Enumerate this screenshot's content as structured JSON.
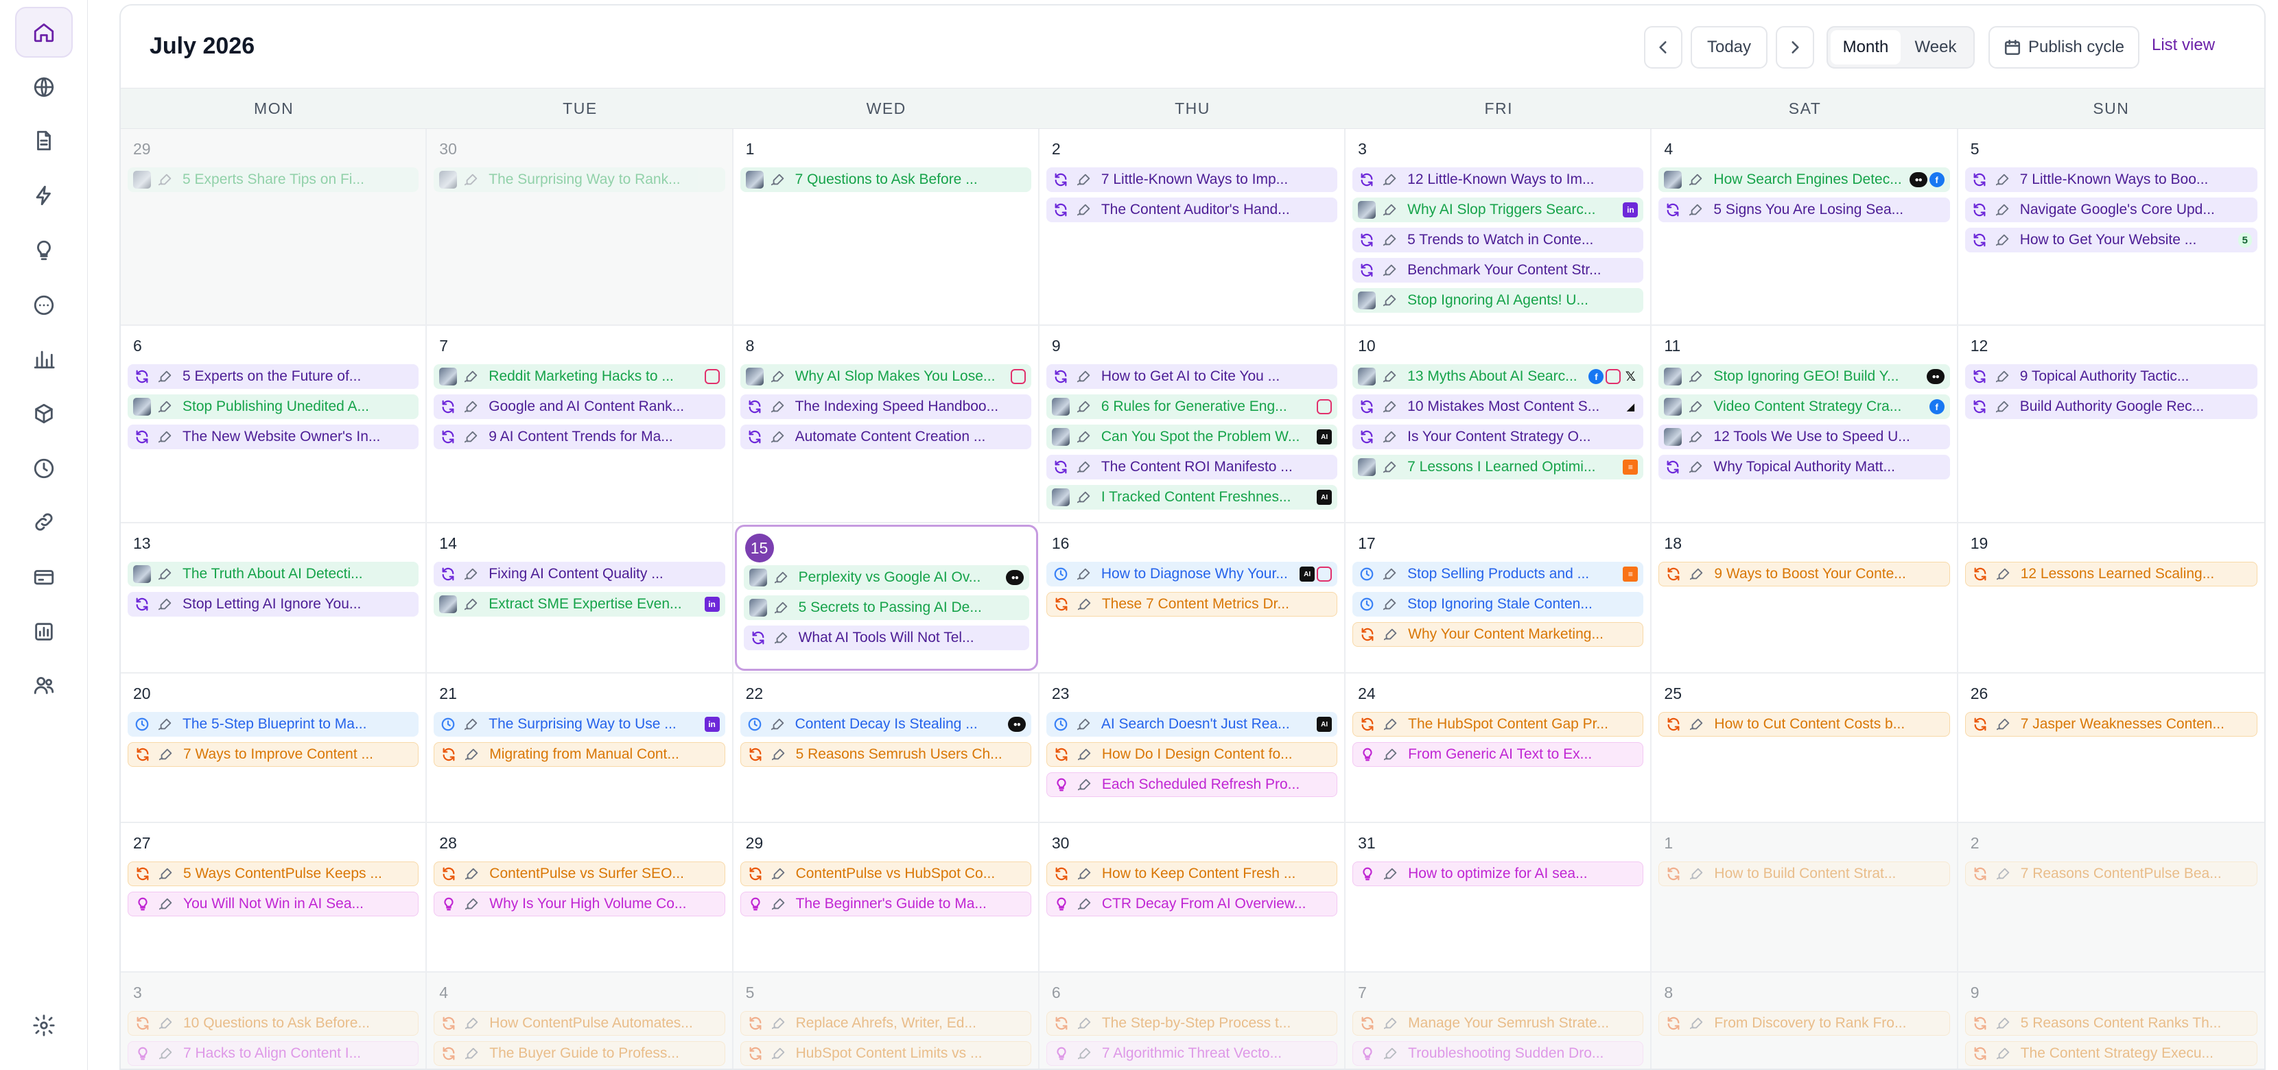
{
  "sidebar": {
    "items": [
      {
        "icon": "home-icon",
        "active": true
      },
      {
        "icon": "globe-icon"
      },
      {
        "icon": "document-icon"
      },
      {
        "icon": "lightning-icon"
      },
      {
        "icon": "lightbulb-icon"
      },
      {
        "icon": "more-circle-icon"
      },
      {
        "icon": "bar-chart-icon"
      },
      {
        "icon": "cube-icon"
      },
      {
        "icon": "clock-icon"
      },
      {
        "icon": "link-icon"
      },
      {
        "icon": "credit-card-icon"
      },
      {
        "icon": "analytics-icon"
      },
      {
        "icon": "users-icon"
      }
    ],
    "settings_icon": "settings-icon"
  },
  "header": {
    "title": "July 2026",
    "today_label": "Today",
    "month_label": "Month",
    "week_label": "Week",
    "publish_cycle_label": "Publish cycle",
    "list_view_label": "List view"
  },
  "weekdays": [
    "MON",
    "TUE",
    "WED",
    "THU",
    "FRI",
    "SAT",
    "SUN"
  ],
  "weeks": [
    {
      "days": [
        {
          "num": "29",
          "other": true,
          "events": [
            {
              "color": "green",
              "lead": "thumb",
              "title": "5 Experts Share Tips on Fi..."
            }
          ]
        },
        {
          "num": "30",
          "other": true,
          "events": [
            {
              "color": "green",
              "lead": "thumb",
              "title": "The Surprising Way to Rank..."
            }
          ]
        },
        {
          "num": "1",
          "events": [
            {
              "color": "green",
              "lead": "thumb",
              "title": "7 Questions to Ask Before ..."
            }
          ]
        },
        {
          "num": "2",
          "events": [
            {
              "color": "purple",
              "lead": "refresh",
              "title": "7 Little-Known Ways to Imp..."
            },
            {
              "color": "purple",
              "lead": "refresh",
              "title": "The Content Auditor's Hand..."
            }
          ]
        },
        {
          "num": "3",
          "events": [
            {
              "color": "purple",
              "lead": "refresh",
              "title": "12 Little-Known Ways to Im..."
            },
            {
              "color": "green",
              "lead": "thumb",
              "title": "Why AI Slop Triggers Searc...",
              "plats": [
                "li"
              ]
            },
            {
              "color": "purple",
              "lead": "refresh",
              "title": "5 Trends to Watch in Conte..."
            },
            {
              "color": "purple",
              "lead": "refresh",
              "title": "Benchmark Your Content Str..."
            },
            {
              "color": "green",
              "lead": "thumb",
              "title": "Stop Ignoring AI Agents! U..."
            }
          ]
        },
        {
          "num": "4",
          "events": [
            {
              "color": "green",
              "lead": "thumb",
              "title": "How Search Engines Detec...",
              "plats": [
                "med",
                "fb"
              ]
            },
            {
              "color": "purple",
              "lead": "refresh",
              "title": "5 Signs You Are Losing Sea..."
            }
          ]
        },
        {
          "num": "5",
          "events": [
            {
              "color": "purple",
              "lead": "refresh",
              "title": "7 Little-Known Ways to Boo..."
            },
            {
              "color": "purple",
              "lead": "refresh",
              "title": "Navigate Google's Core Upd..."
            },
            {
              "color": "purple",
              "lead": "refresh",
              "title": "How to Get Your Website ...",
              "plats": [
                "count"
              ],
              "count": "5"
            }
          ]
        }
      ]
    },
    {
      "days": [
        {
          "num": "6",
          "events": [
            {
              "color": "purple",
              "lead": "refresh",
              "title": "5 Experts on the Future of..."
            },
            {
              "color": "green",
              "lead": "thumb",
              "title": "Stop Publishing Unedited A..."
            },
            {
              "color": "purple",
              "lead": "refresh",
              "title": "The New Website Owner's In..."
            }
          ]
        },
        {
          "num": "7",
          "events": [
            {
              "color": "green",
              "lead": "thumb",
              "title": "Reddit Marketing Hacks to ...",
              "plats": [
                "ig"
              ]
            },
            {
              "color": "purple",
              "lead": "refresh",
              "title": "Google and AI Content Rank..."
            },
            {
              "color": "purple",
              "lead": "refresh",
              "title": "9 AI Content Trends for Ma..."
            }
          ]
        },
        {
          "num": "8",
          "events": [
            {
              "color": "green",
              "lead": "thumb",
              "title": "Why AI Slop Makes You Lose...",
              "plats": [
                "ig"
              ]
            },
            {
              "color": "purple",
              "lead": "refresh",
              "title": "The Indexing Speed Handboo..."
            },
            {
              "color": "purple",
              "lead": "refresh",
              "title": "Automate Content Creation ..."
            }
          ]
        },
        {
          "num": "9",
          "events": [
            {
              "color": "purple",
              "lead": "refresh",
              "title": "How to Get AI to Cite You ..."
            },
            {
              "color": "green",
              "lead": "thumb",
              "title": "6 Rules for Generative Eng...",
              "plats": [
                "ig"
              ]
            },
            {
              "color": "green",
              "lead": "thumb",
              "title": "Can You Spot the Problem W...",
              "plats": [
                "ai"
              ]
            },
            {
              "color": "purple",
              "lead": "refresh",
              "title": "The Content ROI Manifesto ..."
            },
            {
              "color": "green",
              "lead": "thumb",
              "title": "I Tracked Content Freshnes...",
              "plats": [
                "ai"
              ]
            }
          ]
        },
        {
          "num": "10",
          "events": [
            {
              "color": "green",
              "lead": "thumb",
              "title": "13 Myths About AI Searc...",
              "plats": [
                "fb",
                "ig",
                "x"
              ]
            },
            {
              "color": "purple",
              "lead": "refresh",
              "title": "10 Mistakes Most Content S...",
              "plats": [
                "bars"
              ]
            },
            {
              "color": "purple",
              "lead": "refresh",
              "title": "Is Your Content Strategy O..."
            },
            {
              "color": "green",
              "lead": "thumb",
              "title": "7 Lessons I Learned Optimi...",
              "plats": [
                "sub"
              ]
            }
          ]
        },
        {
          "num": "11",
          "events": [
            {
              "color": "green",
              "lead": "thumb",
              "title": "Stop Ignoring GEO! Build Y...",
              "plats": [
                "med"
              ]
            },
            {
              "color": "green",
              "lead": "thumb",
              "title": "Video Content Strategy Cra...",
              "plats": [
                "fb"
              ]
            },
            {
              "color": "purple",
              "lead": "thumb",
              "title": "12 Tools We Use to Speed U..."
            },
            {
              "color": "purple",
              "lead": "refresh",
              "title": "Why Topical Authority Matt..."
            }
          ]
        },
        {
          "num": "12",
          "events": [
            {
              "color": "purple",
              "lead": "refresh",
              "title": "9 Topical Authority Tactic..."
            },
            {
              "color": "purple",
              "lead": "refresh",
              "title": "Build Authority Google Rec..."
            }
          ]
        }
      ]
    },
    {
      "days": [
        {
          "num": "13",
          "events": [
            {
              "color": "green",
              "lead": "thumb",
              "title": "The Truth About AI Detecti..."
            },
            {
              "color": "purple",
              "lead": "refresh",
              "title": "Stop Letting AI Ignore You..."
            }
          ]
        },
        {
          "num": "14",
          "events": [
            {
              "color": "purple",
              "lead": "refresh",
              "title": "Fixing AI Content Quality ..."
            },
            {
              "color": "green",
              "lead": "thumb",
              "title": "Extract SME Expertise Even...",
              "plats": [
                "li"
              ]
            }
          ]
        },
        {
          "num": "15",
          "today": true,
          "events": [
            {
              "color": "green",
              "lead": "thumb",
              "title": "Perplexity vs Google AI Ov...",
              "plats": [
                "med"
              ]
            },
            {
              "color": "green",
              "lead": "thumb",
              "title": "5 Secrets to Passing AI De..."
            },
            {
              "color": "purple",
              "lead": "refresh",
              "title": "What AI Tools Will Not Tel..."
            }
          ]
        },
        {
          "num": "16",
          "events": [
            {
              "color": "blue",
              "lead": "clock",
              "title": "How to Diagnose Why Your...",
              "plats": [
                "ai",
                "ig"
              ]
            },
            {
              "color": "orange",
              "lead": "refresh",
              "title": "These 7 Content Metrics Dr..."
            }
          ]
        },
        {
          "num": "17",
          "events": [
            {
              "color": "blue",
              "lead": "clock",
              "title": "Stop Selling Products and ...",
              "plats": [
                "sub"
              ]
            },
            {
              "color": "blue",
              "lead": "clock",
              "title": "Stop Ignoring Stale Conten..."
            },
            {
              "color": "orange",
              "lead": "refresh",
              "title": "Why Your Content Marketing..."
            }
          ]
        },
        {
          "num": "18",
          "events": [
            {
              "color": "orange",
              "lead": "refresh",
              "title": "9 Ways to Boost Your Conte..."
            }
          ]
        },
        {
          "num": "19",
          "events": [
            {
              "color": "orange",
              "lead": "refresh",
              "title": "12 Lessons Learned Scaling..."
            }
          ]
        }
      ]
    },
    {
      "days": [
        {
          "num": "20",
          "events": [
            {
              "color": "blue",
              "lead": "clock",
              "title": "The 5-Step Blueprint to Ma..."
            },
            {
              "color": "orange",
              "lead": "refresh",
              "title": "7 Ways to Improve Content ..."
            }
          ]
        },
        {
          "num": "21",
          "events": [
            {
              "color": "blue",
              "lead": "clock",
              "title": "The Surprising Way to Use ...",
              "plats": [
                "li"
              ]
            },
            {
              "color": "orange",
              "lead": "refresh",
              "title": "Migrating from Manual Cont..."
            }
          ]
        },
        {
          "num": "22",
          "events": [
            {
              "color": "blue",
              "lead": "clock",
              "title": "Content Decay Is Stealing ...",
              "plats": [
                "med"
              ]
            },
            {
              "color": "orange",
              "lead": "refresh",
              "title": "5 Reasons Semrush Users Ch..."
            }
          ]
        },
        {
          "num": "23",
          "events": [
            {
              "color": "blue",
              "lead": "clock",
              "title": "AI Search Doesn't Just Rea...",
              "plats": [
                "ai"
              ]
            },
            {
              "color": "orange",
              "lead": "refresh",
              "title": "How Do I Design Content fo..."
            },
            {
              "color": "pink",
              "lead": "bulb",
              "title": "Each Scheduled Refresh Pro..."
            }
          ]
        },
        {
          "num": "24",
          "events": [
            {
              "color": "orange",
              "lead": "refresh",
              "title": "The HubSpot Content Gap Pr..."
            },
            {
              "color": "pink",
              "lead": "bulb",
              "title": "From Generic AI Text to Ex..."
            }
          ]
        },
        {
          "num": "25",
          "events": [
            {
              "color": "orange",
              "lead": "refresh",
              "title": "How to Cut Content Costs b..."
            }
          ]
        },
        {
          "num": "26",
          "events": [
            {
              "color": "orange",
              "lead": "refresh",
              "title": "7 Jasper Weaknesses Conten..."
            }
          ]
        }
      ]
    },
    {
      "days": [
        {
          "num": "27",
          "events": [
            {
              "color": "orange",
              "lead": "refresh",
              "title": "5 Ways ContentPulse Keeps ..."
            },
            {
              "color": "pink",
              "lead": "bulb",
              "title": "You Will Not Win in AI Sea..."
            }
          ]
        },
        {
          "num": "28",
          "events": [
            {
              "color": "orange",
              "lead": "refresh",
              "title": "ContentPulse vs Surfer SEO..."
            },
            {
              "color": "pink",
              "lead": "bulb",
              "title": "Why Is Your High Volume Co..."
            }
          ]
        },
        {
          "num": "29",
          "events": [
            {
              "color": "orange",
              "lead": "refresh",
              "title": "ContentPulse vs HubSpot Co..."
            },
            {
              "color": "pink",
              "lead": "bulb",
              "title": "The Beginner's Guide to Ma..."
            }
          ]
        },
        {
          "num": "30",
          "events": [
            {
              "color": "orange",
              "lead": "refresh",
              "title": "How to Keep Content Fresh ..."
            },
            {
              "color": "pink",
              "lead": "bulb",
              "title": "CTR Decay From AI Overview..."
            }
          ]
        },
        {
          "num": "31",
          "events": [
            {
              "color": "pink",
              "lead": "bulb",
              "title": "How to optimize for AI sea..."
            }
          ]
        },
        {
          "num": "1",
          "other": true,
          "events": [
            {
              "color": "orange",
              "lead": "refresh",
              "title": "How to Build Content Strat..."
            }
          ]
        },
        {
          "num": "2",
          "other": true,
          "events": [
            {
              "color": "orange",
              "lead": "refresh",
              "title": "7 Reasons ContentPulse Bea..."
            }
          ]
        }
      ]
    },
    {
      "days": [
        {
          "num": "3",
          "other": true,
          "events": [
            {
              "color": "orange",
              "lead": "refresh",
              "title": "10 Questions to Ask Before..."
            },
            {
              "color": "pink",
              "lead": "bulb",
              "title": "7 Hacks to Align Content I..."
            }
          ]
        },
        {
          "num": "4",
          "other": true,
          "events": [
            {
              "color": "orange",
              "lead": "refresh",
              "title": "How ContentPulse Automates..."
            },
            {
              "color": "orange",
              "lead": "refresh",
              "title": "The Buyer Guide to Profess..."
            }
          ]
        },
        {
          "num": "5",
          "other": true,
          "events": [
            {
              "color": "orange",
              "lead": "refresh",
              "title": "Replace Ahrefs, Writer, Ed..."
            },
            {
              "color": "orange",
              "lead": "refresh",
              "title": "HubSpot Content Limits vs ..."
            }
          ]
        },
        {
          "num": "6",
          "other": true,
          "events": [
            {
              "color": "orange",
              "lead": "refresh",
              "title": "The Step-by-Step Process t..."
            },
            {
              "color": "pink",
              "lead": "bulb",
              "title": "7 Algorithmic Threat Vecto..."
            }
          ]
        },
        {
          "num": "7",
          "other": true,
          "events": [
            {
              "color": "orange",
              "lead": "refresh",
              "title": "Manage Your Semrush Strate..."
            },
            {
              "color": "pink",
              "lead": "bulb",
              "title": "Troubleshooting Sudden Dro..."
            }
          ]
        },
        {
          "num": "8",
          "other": true,
          "events": [
            {
              "color": "orange",
              "lead": "refresh",
              "title": "From Discovery to Rank Fro..."
            }
          ]
        },
        {
          "num": "9",
          "other": true,
          "events": [
            {
              "color": "orange",
              "lead": "refresh",
              "title": "5 Reasons Content Ranks Th..."
            },
            {
              "color": "orange",
              "lead": "refresh",
              "title": "The Content Strategy Execu..."
            }
          ]
        }
      ]
    }
  ]
}
